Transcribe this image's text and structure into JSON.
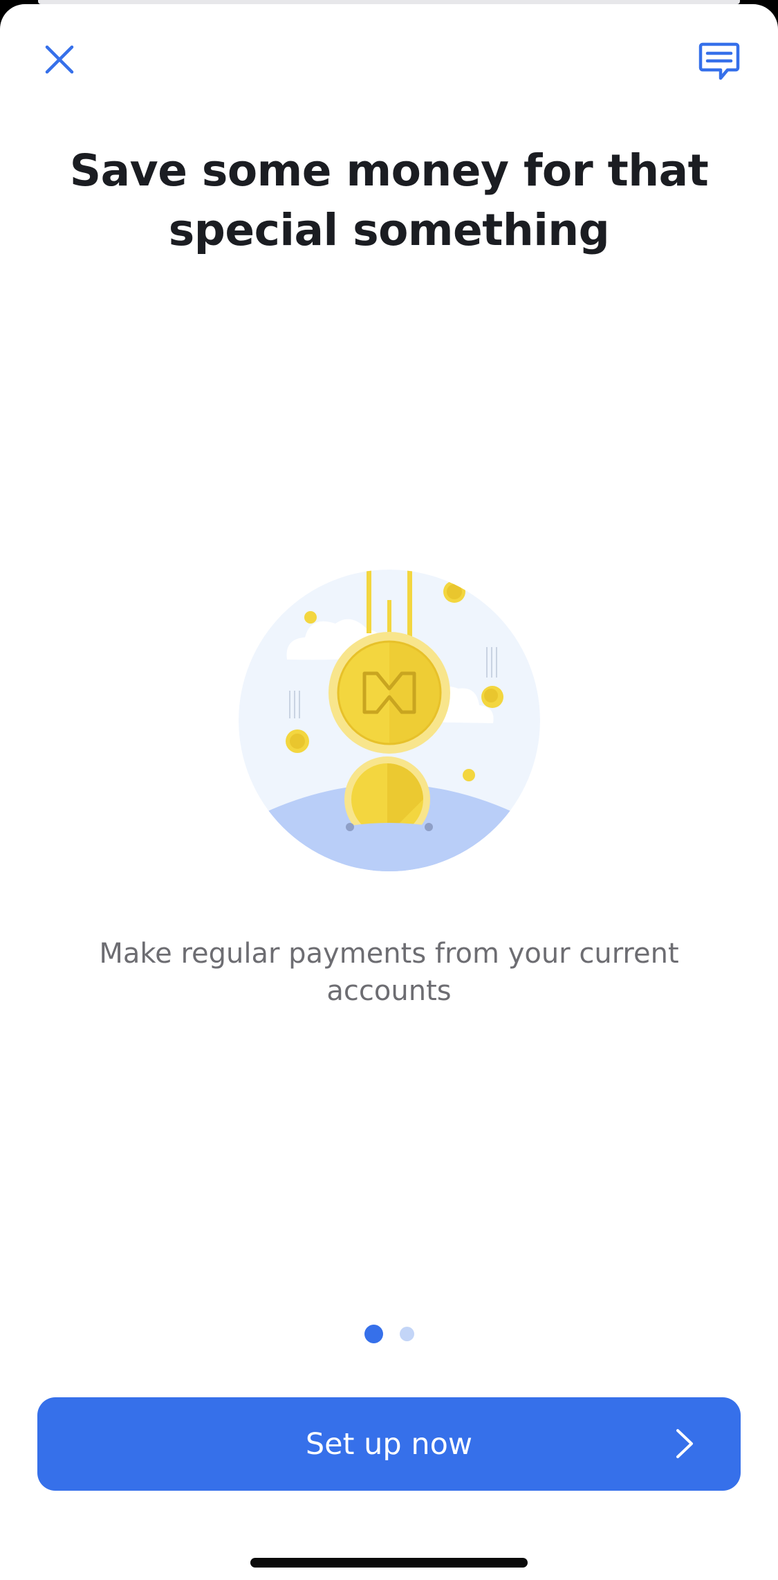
{
  "header": {
    "close_icon": "close-icon",
    "chat_icon": "chat-icon"
  },
  "content": {
    "title_line_1": "Save some money for that",
    "title_line_2": "special something",
    "subtitle_line_1": "Make regular payments from your current",
    "subtitle_line_2": "accounts",
    "illustration_icon": "coins-falling-illustration"
  },
  "pager": {
    "total_pages": 2,
    "current_page": 1
  },
  "footer": {
    "primary_button_label": "Set up now",
    "primary_button_icon": "chevron-right-icon"
  },
  "colors": {
    "accent": "#3670ea",
    "title": "#1b1d22",
    "subtitle": "#6d6d72",
    "coin_gold": "#f3d63f",
    "ground": "#b9cef8",
    "circle_bg": "#eff5fd"
  }
}
